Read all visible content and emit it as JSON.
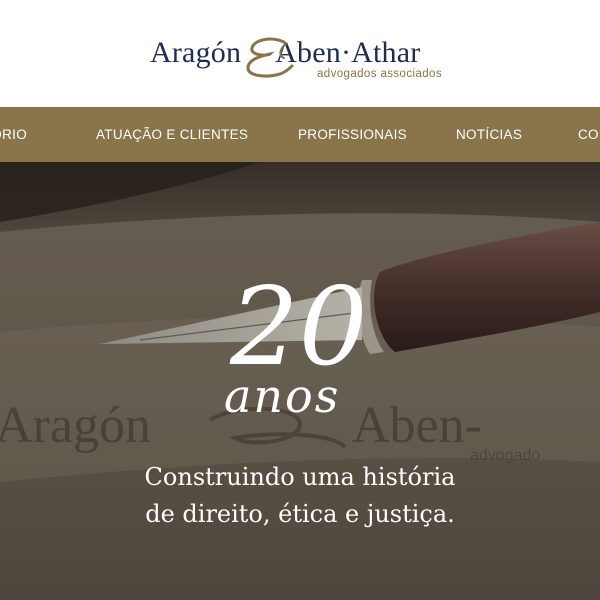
{
  "logo": {
    "name_left": "Aragón",
    "name_right": "Aben·Athar",
    "subtitle": "advogados associados"
  },
  "nav": {
    "items": [
      {
        "label": "ESCRITÓRIO"
      },
      {
        "label": "ATUAÇÃO E CLIENTES"
      },
      {
        "label": "PROFISSIONAIS"
      },
      {
        "label": "NOTÍCIAS"
      },
      {
        "label": "CONTATO"
      }
    ]
  },
  "hero": {
    "number": "20",
    "word": "anos",
    "tagline_line1": "Construindo uma história",
    "tagline_line2": "de direito, ética e justiça.",
    "watermark_left": "Aragón",
    "watermark_right": "Aben-",
    "watermark_sub": "advogado"
  },
  "colors": {
    "brand_navy": "#1f2c4f",
    "brand_gold": "#8a744b",
    "nav_text": "#ffffff"
  }
}
